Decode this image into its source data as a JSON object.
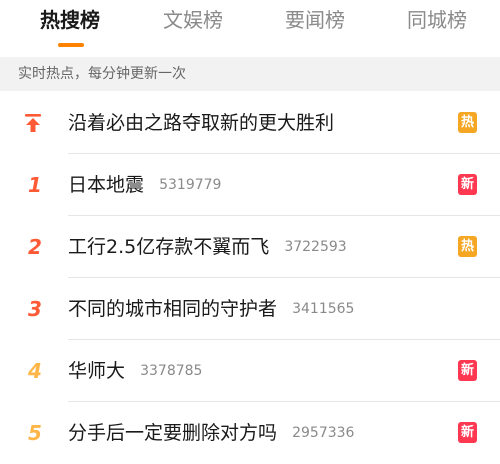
{
  "tabs": [
    {
      "label": "热搜榜",
      "active": true
    },
    {
      "label": "文娱榜",
      "active": false
    },
    {
      "label": "要闻榜",
      "active": false
    },
    {
      "label": "同城榜",
      "active": false
    }
  ],
  "subheader": "实时热点，每分钟更新一次",
  "colors": {
    "accent": "#ff8200",
    "badge_hot": "#f5a623",
    "badge_new": "#ff3852",
    "rank_top": "#ff5a36",
    "rank_mid": "#ff8a3d",
    "rank_low": "#ffb648",
    "pin": "#ff5a36"
  },
  "items": [
    {
      "rank": "",
      "pinned": true,
      "title": "沿着必由之路夺取新的更大胜利",
      "count": "",
      "badge": "热",
      "badge_type": "hot"
    },
    {
      "rank": "1",
      "pinned": false,
      "title": "日本地震",
      "count": "5319779",
      "badge": "新",
      "badge_type": "new"
    },
    {
      "rank": "2",
      "pinned": false,
      "title": "工行2.5亿存款不翼而飞",
      "count": "3722593",
      "badge": "热",
      "badge_type": "hot"
    },
    {
      "rank": "3",
      "pinned": false,
      "title": "不同的城市相同的守护者",
      "count": "3411565",
      "badge": "",
      "badge_type": ""
    },
    {
      "rank": "4",
      "pinned": false,
      "title": "华师大",
      "count": "3378785",
      "badge": "新",
      "badge_type": "new"
    },
    {
      "rank": "5",
      "pinned": false,
      "title": "分手后一定要删除对方吗",
      "count": "2957336",
      "badge": "新",
      "badge_type": "new"
    }
  ]
}
